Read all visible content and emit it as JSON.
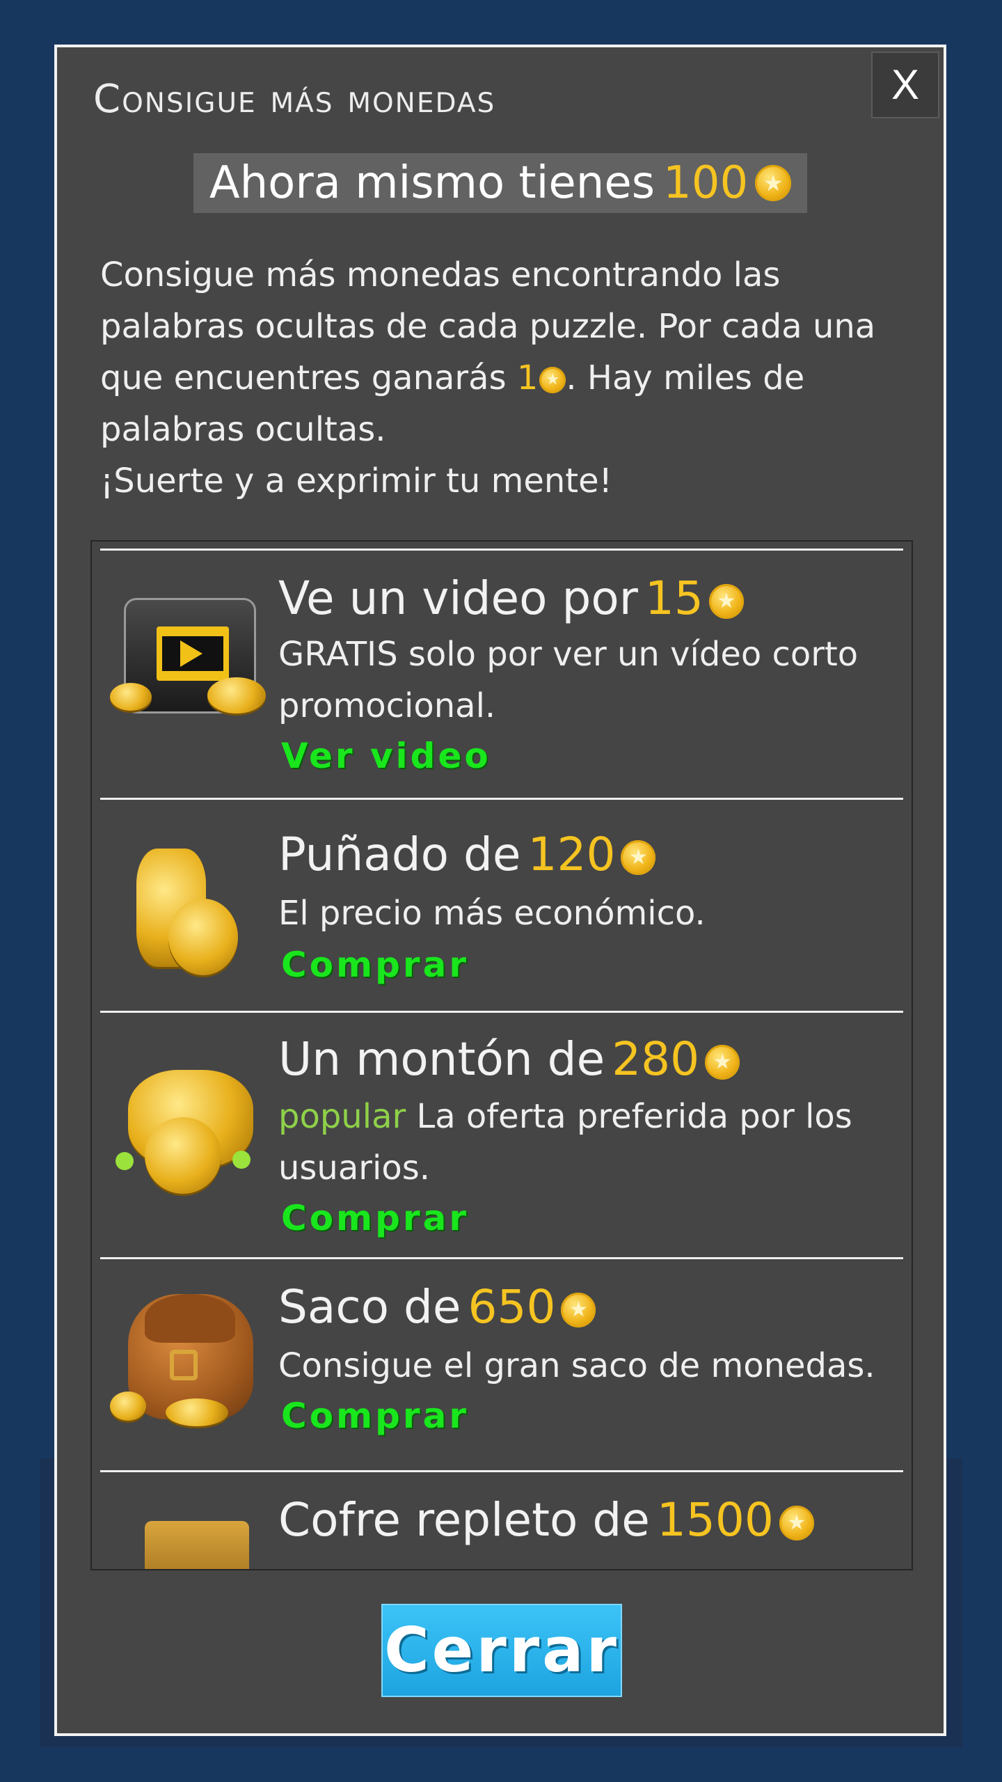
{
  "dialog": {
    "title": "Consigue más monedas",
    "close_x": "X",
    "balance_prefix": "Ahora mismo tienes",
    "balance_amount": "100",
    "intro_line1": "Consigue más monedas encontrando las",
    "intro_line2": "palabras ocultas de cada puzzle. Por cada una",
    "intro_line3a": "que encuentres ganarás",
    "intro_reward": "1",
    "intro_line3b": ". Hay miles de",
    "intro_line4": "palabras ocultas.",
    "intro_line5": "¡Suerte y a exprimir tu mente!",
    "close_button": "Cerrar"
  },
  "offers": [
    {
      "title": "Ve un video por",
      "amount": "15",
      "desc_line1": "GRATIS solo por ver un vídeo corto",
      "desc_line2": "promocional.",
      "action": "Ver video",
      "icon": "video-coins-icon"
    },
    {
      "title": "Puñado de",
      "amount": "120",
      "desc_line1": "El precio más económico.",
      "action": "Comprar",
      "icon": "coin-stack-icon"
    },
    {
      "title": "Un montón de",
      "amount": "280",
      "tag": "popular",
      "desc_line1": "La oferta preferida por los",
      "desc_line2": "usuarios.",
      "action": "Comprar",
      "icon": "coin-pile-icon"
    },
    {
      "title": "Saco de",
      "amount": "650",
      "desc_line1": "Consigue el gran saco de monedas.",
      "action": "Comprar",
      "icon": "coin-bag-icon"
    },
    {
      "title": "Cofre repleto de",
      "amount": "1500",
      "icon": "treasure-chest-icon"
    }
  ]
}
